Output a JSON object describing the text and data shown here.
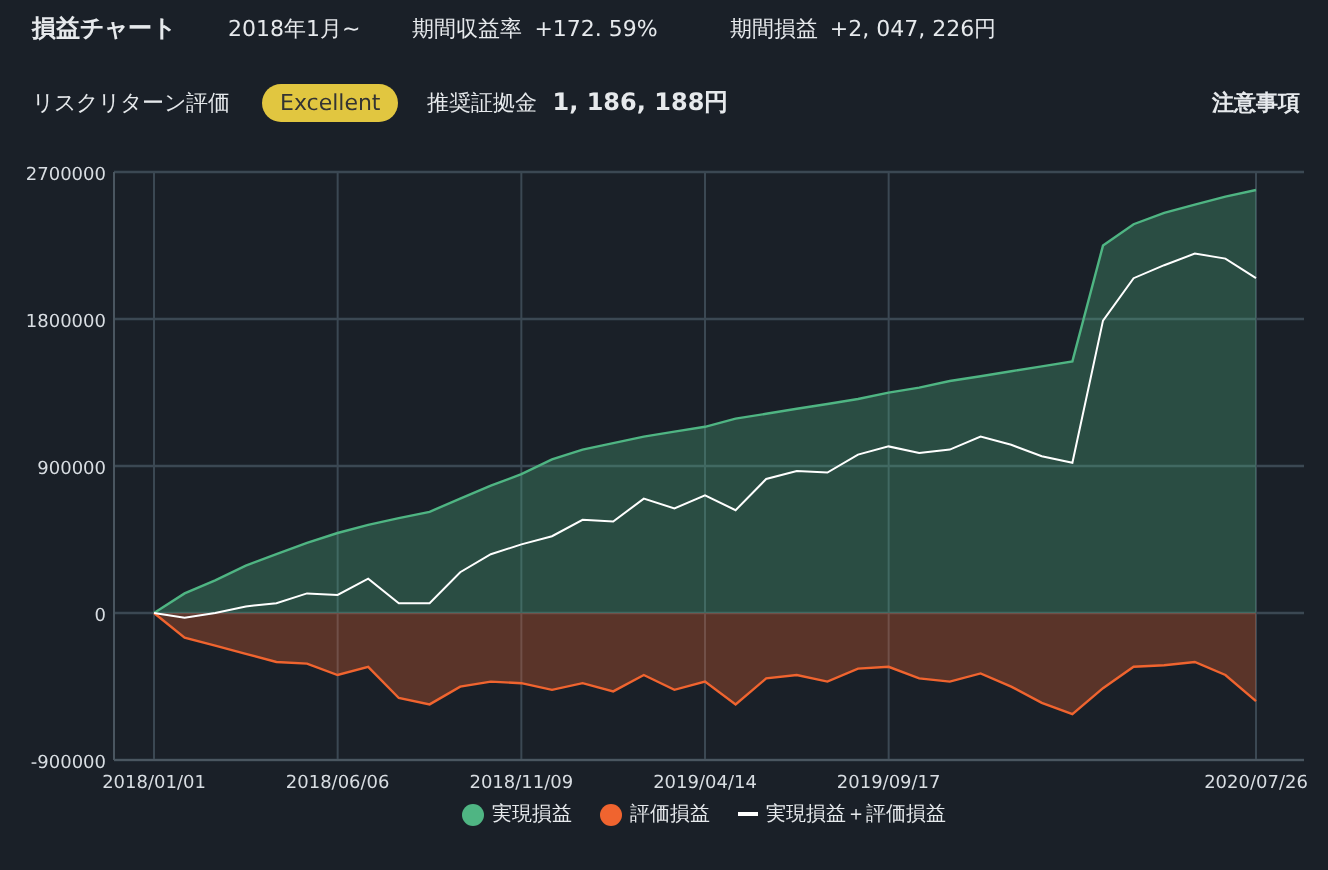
{
  "header": {
    "title": "損益チャート",
    "period": "2018年1月~",
    "stats": [
      {
        "label": "期間収益率",
        "value": "+172. 59%"
      },
      {
        "label": "期間損益",
        "value": "+2, 047, 226円"
      }
    ]
  },
  "rating": {
    "label": "リスクリターン評価",
    "badge": "Excellent",
    "margin_label": "推奨証拠金",
    "margin_value": "1, 186, 188円",
    "notice": "注意事項"
  },
  "chart_data": {
    "type": "area",
    "categories": [
      "2018/01/01",
      null,
      null,
      null,
      null,
      null,
      "2018/06/06",
      null,
      null,
      null,
      null,
      null,
      "2018/11/09",
      null,
      null,
      null,
      null,
      null,
      "2019/04/14",
      null,
      null,
      null,
      null,
      null,
      "2019/09/17",
      null,
      null,
      null,
      null,
      null,
      null,
      null,
      null,
      null,
      null,
      null,
      "2020/07/26"
    ],
    "ylim": [
      -900000,
      2700000
    ],
    "grid": true,
    "yticks": [
      -900000,
      0,
      900000,
      1800000,
      2700000
    ],
    "series": [
      {
        "name": "実現損益",
        "color": "#4fb583",
        "values": [
          0,
          120000,
          200000,
          290000,
          360000,
          430000,
          490000,
          540000,
          580000,
          620000,
          700000,
          780000,
          850000,
          940000,
          1000000,
          1040000,
          1080000,
          1110000,
          1140000,
          1190000,
          1220000,
          1250000,
          1280000,
          1310000,
          1350000,
          1380000,
          1420000,
          1450000,
          1480000,
          1510000,
          1540000,
          2250000,
          2380000,
          2450000,
          2500000,
          2550000,
          2590000
        ]
      },
      {
        "name": "評価損益",
        "color": "#f0642f",
        "values": [
          0,
          -150000,
          -200000,
          -250000,
          -300000,
          -310000,
          -380000,
          -330000,
          -520000,
          -560000,
          -450000,
          -420000,
          -430000,
          -470000,
          -430000,
          -480000,
          -380000,
          -470000,
          -420000,
          -560000,
          -400000,
          -380000,
          -420000,
          -340000,
          -330000,
          -400000,
          -420000,
          -370000,
          -450000,
          -550000,
          -620000,
          -460000,
          -330000,
          -320000,
          -300000,
          -380000,
          -540000
        ]
      },
      {
        "name": "実現損益＋評価損益",
        "type": "line",
        "color": "#ffffff",
        "values": [
          0,
          -30000,
          0,
          40000,
          60000,
          120000,
          110000,
          210000,
          60000,
          60000,
          250000,
          360000,
          420000,
          470000,
          570000,
          560000,
          700000,
          640000,
          720000,
          630000,
          820000,
          870000,
          860000,
          970000,
          1020000,
          980000,
          1000000,
          1080000,
          1030000,
          960000,
          920000,
          1790000,
          2050000,
          2130000,
          2200000,
          2170000,
          2050000
        ]
      }
    ]
  }
}
